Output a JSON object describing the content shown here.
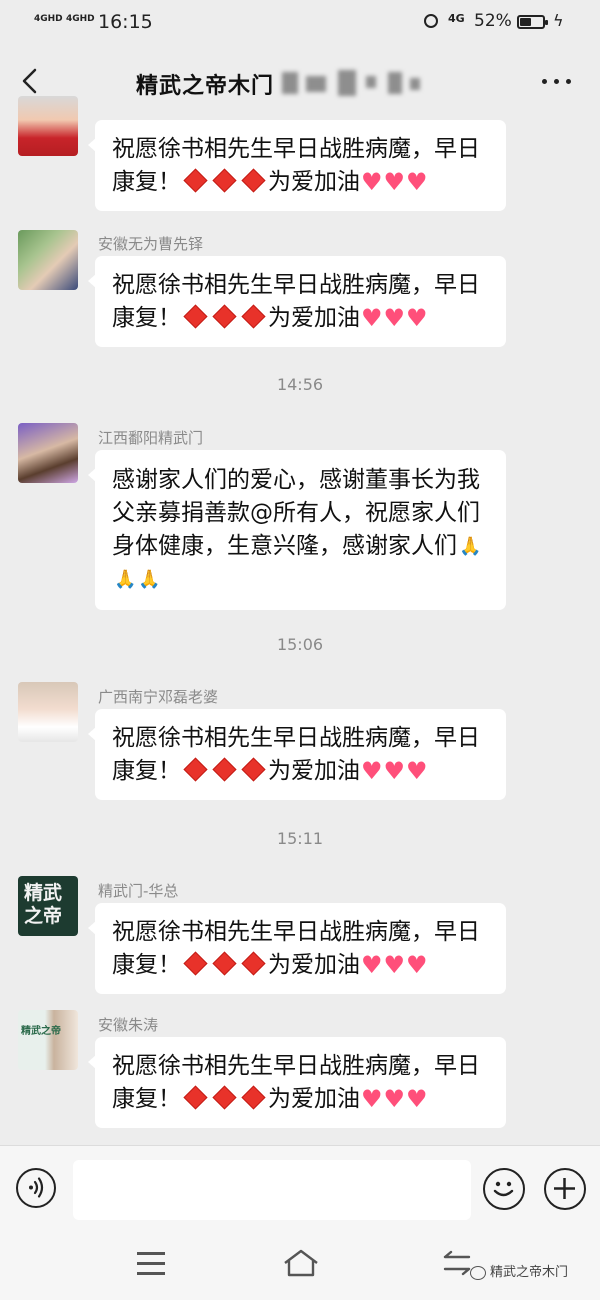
{
  "status_bar": {
    "signal_1": "4GHD",
    "signal_2": "4GHD",
    "time": "16:15",
    "network": "4G",
    "battery_percent_text": "52%",
    "battery_level": 0.52
  },
  "header": {
    "title": "精武之帝木门"
  },
  "messages": [
    {
      "sender": "",
      "text": "祝愿徐书相先生早日战胜病魔，早日康复！",
      "suffix": "为爱加油",
      "emoji": "diamonds-hearts"
    },
    {
      "sender": "安徽无为曹先铎",
      "text": "祝愿徐书相先生早日战胜病魔，早日康复！",
      "suffix": "为爱加油",
      "emoji": "diamonds-hearts"
    },
    {
      "sender": "江西鄱阳精武门",
      "text": "感谢家人们的爱心，感谢董事长为我父亲募捐善款@所有人，祝愿家人们身体健康，生意兴隆，感谢家人们",
      "emoji": "pray"
    },
    {
      "sender": "广西南宁邓磊老婆",
      "text": "祝愿徐书相先生早日战胜病魔，早日康复！",
      "suffix": "为爱加油",
      "emoji": "diamonds-hearts"
    },
    {
      "sender": "精武门-华总",
      "text": "祝愿徐书相先生早日战胜病魔，早日康复！",
      "suffix": "为爱加油",
      "emoji": "diamonds-hearts"
    },
    {
      "sender": "安徽朱涛",
      "text": "祝愿徐书相先生早日战胜病魔，早日康复！",
      "suffix": "为爱加油",
      "emoji": "diamonds-hearts"
    }
  ],
  "timestamps": [
    "14:56",
    "15:06",
    "15:11"
  ],
  "avatars": {
    "jingwu_logo_text": "精武之帝",
    "jingwu_small_text": "精武之帝"
  },
  "input": {
    "value": ""
  },
  "watermark": {
    "text": "精武之帝木门"
  },
  "colors": {
    "background": "#ededed",
    "bubble": "#ffffff",
    "heart": "#ff4f7a",
    "diamond": "#e8322a"
  }
}
